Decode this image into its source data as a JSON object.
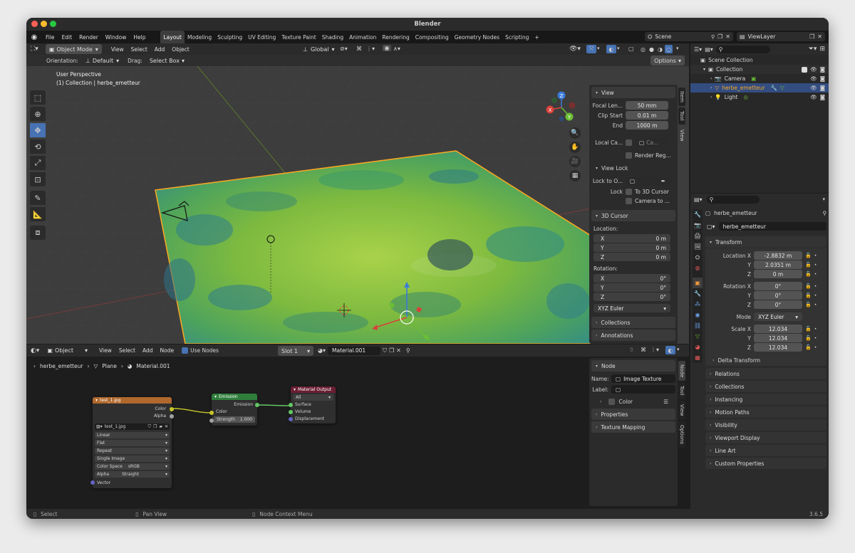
{
  "window": {
    "title": "Blender",
    "version": "3.6.5"
  },
  "menubar": {
    "items": [
      "File",
      "Edit",
      "Render",
      "Window",
      "Help"
    ]
  },
  "workspace_tabs": [
    {
      "label": "Layout",
      "active": true
    },
    {
      "label": "Modeling"
    },
    {
      "label": "Sculpting"
    },
    {
      "label": "UV Editing"
    },
    {
      "label": "Texture Paint"
    },
    {
      "label": "Shading"
    },
    {
      "label": "Animation"
    },
    {
      "label": "Rendering"
    },
    {
      "label": "Compositing"
    },
    {
      "label": "Geometry Nodes"
    },
    {
      "label": "Scripting"
    },
    {
      "label": "+"
    }
  ],
  "scene": {
    "name": "Scene",
    "view_layer": "ViewLayer"
  },
  "viewport_header": {
    "mode": "Object Mode",
    "menus": [
      "View",
      "Select",
      "Add",
      "Object"
    ],
    "transform_space": "Global",
    "orientation_label": "Orientation:",
    "orientation": "Default",
    "drag_label": "Drag:",
    "drag": "Select Box",
    "options": "Options"
  },
  "viewport_overlay": {
    "perspective": "User Perspective",
    "collection": "(1) Collection | herbe_emetteur"
  },
  "gizmo_axes": {
    "x": "X",
    "y": "Y",
    "z": "Z"
  },
  "npanel": {
    "view_header": "View",
    "focal_length_label": "Focal Len...",
    "focal_length": "50 mm",
    "clip_start_label": "Clip Start",
    "clip_start": "0.01 m",
    "clip_end_label": "End",
    "clip_end": "1000 m",
    "local_camera_label": "Local Ca...",
    "local_camera_value": "Ca...",
    "render_region": "Render Reg...",
    "view_lock_header": "View Lock",
    "lock_to_object_label": "Lock to O...",
    "lock_label": "Lock",
    "to_3d_cursor": "To 3D Cursor",
    "camera_to_view": "Camera to ...",
    "cursor_header": "3D Cursor",
    "location_label": "Location:",
    "loc": [
      {
        "axis": "X",
        "value": "0 m"
      },
      {
        "axis": "Y",
        "value": "0 m"
      },
      {
        "axis": "Z",
        "value": "0 m"
      }
    ],
    "rotation_label": "Rotation:",
    "rot": [
      {
        "axis": "X",
        "value": "0°"
      },
      {
        "axis": "Y",
        "value": "0°"
      },
      {
        "axis": "Z",
        "value": "0°"
      }
    ],
    "rotation_mode": "XYZ Euler",
    "collections": "Collections",
    "annotations": "Annotations",
    "side_tabs": [
      "Item",
      "Tool",
      "View"
    ]
  },
  "outliner": {
    "root": "Scene Collection",
    "collection": "Collection",
    "items": [
      {
        "name": "Camera",
        "selected": false
      },
      {
        "name": "herbe_emetteur",
        "selected": true
      },
      {
        "name": "Light",
        "selected": false
      }
    ]
  },
  "properties": {
    "object_name": "herbe_emetteur",
    "datablock": "herbe_emetteur",
    "transform_header": "Transform",
    "location": [
      {
        "label": "Location X",
        "value": "-2.8832 m"
      },
      {
        "label": "Y",
        "value": "2.0351 m"
      },
      {
        "label": "Z",
        "value": "0 m"
      }
    ],
    "rotation": [
      {
        "label": "Rotation X",
        "value": "0°"
      },
      {
        "label": "Y",
        "value": "0°"
      },
      {
        "label": "Z",
        "value": "0°"
      }
    ],
    "mode_label": "Mode",
    "mode": "XYZ Euler",
    "scale": [
      {
        "label": "Scale X",
        "value": "12.034"
      },
      {
        "label": "Y",
        "value": "12.034"
      },
      {
        "label": "Z",
        "value": "12.034"
      }
    ],
    "delta_transform": "Delta Transform",
    "sections": [
      "Relations",
      "Collections",
      "Instancing",
      "Motion Paths",
      "Visibility",
      "Viewport Display",
      "Line Art",
      "Custom Properties"
    ]
  },
  "node_editor": {
    "editor_type": "Object",
    "menus": [
      "View",
      "Select",
      "Add",
      "Node"
    ],
    "use_nodes": "Use Nodes",
    "slot": "Slot 1",
    "material": "Material.001",
    "breadcrumb": [
      "herbe_emetteur",
      "Plane",
      "Material.001"
    ],
    "image_node": {
      "title": "test_1.jpg",
      "out_color": "Color",
      "out_alpha": "Alpha",
      "image": "test_1.jpg",
      "options": [
        "Linear",
        "Flat",
        "Repeat",
        "Single Image"
      ],
      "color_space_label": "Color Space",
      "color_space": "sRGB",
      "alpha_label": "Alpha",
      "alpha": "Straight",
      "in_vector": "Vector"
    },
    "emission_node": {
      "title": "Emission",
      "out": "Emission",
      "in_color": "Color",
      "strength_label": "Strength",
      "strength": "1.000"
    },
    "output_node": {
      "title": "Material Output",
      "target": "All",
      "inputs": [
        "Surface",
        "Volume",
        "Displacement"
      ]
    }
  },
  "node_sidebar": {
    "node_header": "Node",
    "name_label": "Name:",
    "name": "Image Texture",
    "label_label": "Label:",
    "color": "Color",
    "properties": "Properties",
    "texture_mapping": "Texture Mapping",
    "side_tabs": [
      "Node",
      "Tool",
      "View",
      "Options"
    ]
  },
  "statusbar": {
    "select": "Select",
    "pan": "Pan View",
    "context": "Node Context Menu"
  },
  "colors": {
    "accent": "#4772b3",
    "selection": "#f5a623",
    "image_node": "#b0682d",
    "emission_node": "#2f7d3b",
    "output_node": "#6a1f33"
  }
}
